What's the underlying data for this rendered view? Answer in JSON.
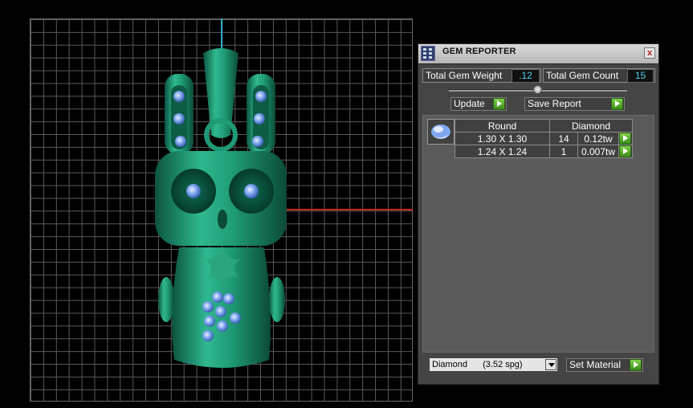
{
  "panel": {
    "title": "GEM REPORTER",
    "close_label": "x",
    "total_weight_label": "Total Gem Weight",
    "total_weight_value": ".12",
    "total_count_label": "Total Gem Count",
    "total_count_value": "15",
    "update_label": "Update",
    "save_report_label": "Save Report",
    "table": {
      "headers": [
        "Round",
        "Diamond"
      ],
      "rows": [
        {
          "size": "1.30 X 1.30",
          "count": "14",
          "weight": "0.12tw"
        },
        {
          "size": "1.24 X 1.24",
          "count": "1",
          "weight": "0.007tw"
        }
      ]
    },
    "material": {
      "name": "Diamond",
      "gravity": "(3.52 spg)"
    },
    "set_material_label": "Set Material"
  },
  "colors": {
    "model_green": "#1f9a76",
    "gem_blue": "#7fa8f0",
    "axis_y": "#2aa9c4",
    "axis_x": "#c8281c",
    "value_text": "#49d2ee",
    "go_green": "#5fb832"
  }
}
